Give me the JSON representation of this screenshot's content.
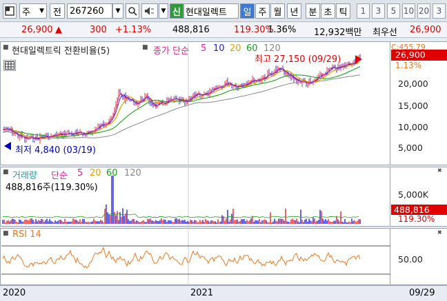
{
  "toolbar": {
    "market_type": "주",
    "jeon": "전",
    "code": "267260",
    "sin": "신",
    "stock_name": "현대일렉트",
    "periods": [
      "일",
      "주",
      "월",
      "년",
      "분",
      "초",
      "틱"
    ],
    "selected_period": "일",
    "interval_buttons": [
      "1",
      "3",
      "5",
      "10",
      "20",
      "3"
    ]
  },
  "quote": {
    "price": "26,900",
    "arrow": "▲",
    "change": "300",
    "change_pct": "+1.13%",
    "volume": "488,816",
    "volume_ratio": "119.30%",
    "turnover": "1.36%",
    "amount": "12,932백만",
    "best_ask_label": "최우선",
    "best_ask": "26,900"
  },
  "price_panel": {
    "title": "현대일렉트릭 전환비율(5)",
    "ma_label": "종가 단순",
    "ma_periods": [
      "5",
      "10",
      "20",
      "60",
      "120"
    ],
    "ma_colors": [
      "#e0208a",
      "#2020d0",
      "#e0a000",
      "#18a018",
      "#888888"
    ],
    "high_label": "최고 27,150 (09/29)",
    "low_label": "최저 4,840 (03/19)",
    "axis_ticks": [
      "20,000",
      "15,000",
      "10,000",
      "5,000"
    ],
    "price_tag": "26,900",
    "pct_tag": "1.13%",
    "cut_tag": "C:455.79"
  },
  "volume_panel": {
    "title": "거래량",
    "ma_label": "단순",
    "ma_periods": [
      "5",
      "20",
      "60",
      "120"
    ],
    "ma_colors": [
      "#e0208a",
      "#e0a000",
      "#18a018",
      "#888888"
    ],
    "value_label": "488,816주(119.30%)",
    "axis_tick": "5,000K",
    "volume_tag": "488,816",
    "pct_tag": "119.30%"
  },
  "rsi_panel": {
    "title": "RSI 14",
    "axis_tick": "50.00"
  },
  "x_axis": {
    "labels": [
      "2020",
      "2021"
    ],
    "last_date": "09/29"
  },
  "colors": {
    "up": "#e00000",
    "down": "#0000d0",
    "rsi": "#e87820",
    "selected_period_bg": "#3a7bd5"
  }
}
